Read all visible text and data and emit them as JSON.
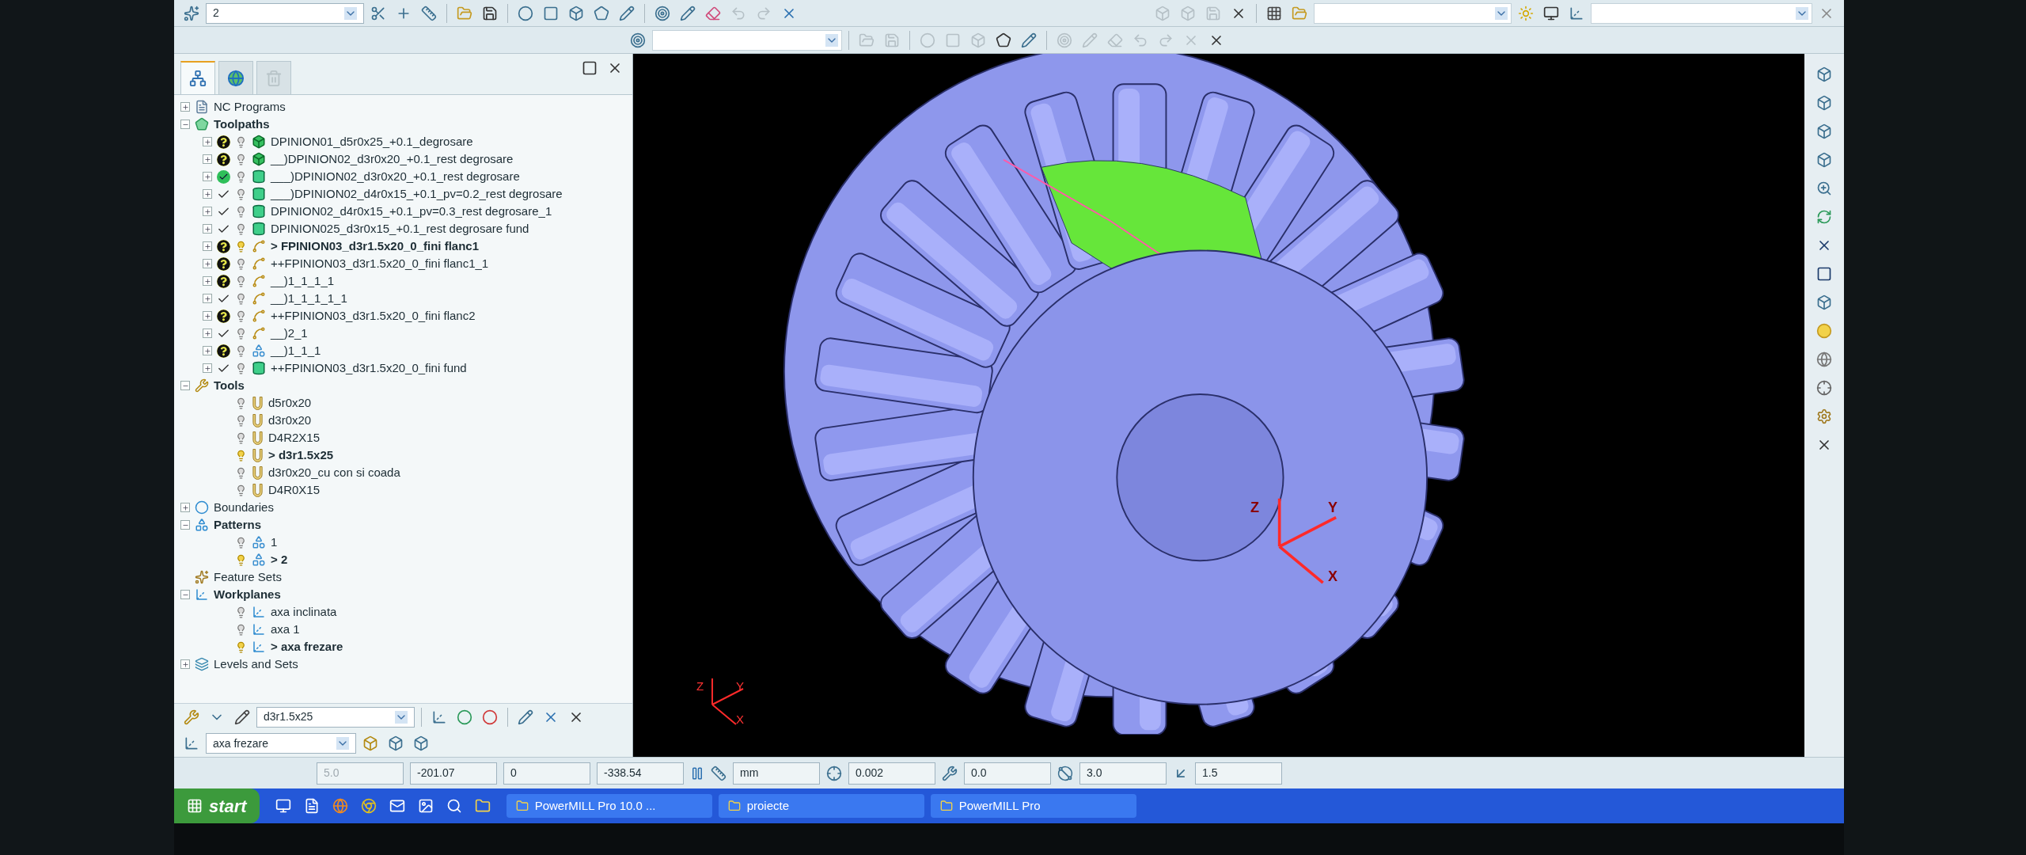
{
  "toolbar": {
    "layer_combo": "2"
  },
  "explorer": {
    "tabs": [
      {
        "selected": true,
        "kind": "tree"
      },
      {
        "selected": false,
        "kind": "globe"
      },
      {
        "selected": false,
        "kind": "bin"
      }
    ],
    "tree": [
      {
        "label": "NC Programs",
        "kind": "nc",
        "expanded": false
      },
      {
        "label": "Toolpaths",
        "kind": "toolpaths",
        "expanded": true,
        "children": [
          {
            "label": "DPINION01_d5r0x25_+0.1_degrosare",
            "calculated": false,
            "kind": "block",
            "active": false
          },
          {
            "label": "__)DPINION02_d3r0x20_+0.1_rest degrosare",
            "calculated": false,
            "kind": "block",
            "active": false
          },
          {
            "label": "___)DPINION02_d3r0x20_+0.1_rest degrosare",
            "calculated": true,
            "verified": true,
            "kind": "cylinder",
            "active": false
          },
          {
            "label": "___)DPINION02_d4r0x15_+0.1_pv=0.2_rest degrosare",
            "calculated": true,
            "verified": false,
            "kind": "cylinder",
            "active": false
          },
          {
            "label": "DPINION02_d4r0x15_+0.1_pv=0.3_rest degrosare_1",
            "calculated": true,
            "verified": false,
            "kind": "cylinder",
            "active": false
          },
          {
            "label": "DPINION025_d3r0x15_+0.1_rest degrosare fund",
            "calculated": true,
            "verified": false,
            "kind": "cylinder",
            "active": false
          },
          {
            "label": "> FPINION03_d3r1.5x20_0_fini flanc1",
            "calculated": false,
            "kind": "finish",
            "active": true
          },
          {
            "label": "++FPINION03_d3r1.5x20_0_fini flanc1_1",
            "calculated": false,
            "kind": "finish",
            "active": false
          },
          {
            "label": "__)1_1_1_1",
            "calculated": false,
            "kind": "finish",
            "active": false
          },
          {
            "label": "__)1_1_1_1_1",
            "calculated": true,
            "verified": false,
            "kind": "finish",
            "active": false
          },
          {
            "label": "++FPINION03_d3r1.5x20_0_fini flanc2",
            "calculated": false,
            "kind": "finish",
            "active": false
          },
          {
            "label": "__)2_1",
            "calculated": true,
            "verified": false,
            "kind": "finish",
            "active": false
          },
          {
            "label": "__)1_1_1",
            "calculated": false,
            "kind": "pattern",
            "active": false
          },
          {
            "label": "++FPINION03_d3r1.5x20_0_fini fund",
            "calculated": true,
            "verified": false,
            "kind": "cylinder",
            "active": false
          }
        ]
      },
      {
        "label": "Tools",
        "kind": "tools",
        "expanded": true,
        "children": [
          {
            "label": "d5r0x20",
            "kind": "tool",
            "active": false
          },
          {
            "label": "d3r0x20",
            "kind": "tool",
            "active": false
          },
          {
            "label": "D4R2X15",
            "kind": "tool",
            "active": false
          },
          {
            "label": "> d3r1.5x25",
            "kind": "tool",
            "active": true
          },
          {
            "label": "d3r0x20_cu con si coada",
            "kind": "tool",
            "active": false
          },
          {
            "label": "D4R0X15",
            "kind": "tool",
            "active": false
          }
        ]
      },
      {
        "label": "Boundaries",
        "kind": "boundaries",
        "expanded": false
      },
      {
        "label": "Patterns",
        "kind": "patterns",
        "expanded": true,
        "children": [
          {
            "label": "1",
            "kind": "pattern",
            "active": false
          },
          {
            "label": "> 2",
            "kind": "pattern",
            "active": true
          }
        ]
      },
      {
        "label": "Feature Sets",
        "kind": "features",
        "expanded": false
      },
      {
        "label": "Workplanes",
        "kind": "workplanes",
        "expanded": true,
        "children": [
          {
            "label": "axa inclinata",
            "kind": "workplane",
            "active": false
          },
          {
            "label": "axa 1",
            "kind": "workplane",
            "active": false
          },
          {
            "label": "> axa frezare",
            "kind": "workplane",
            "active": true
          }
        ]
      },
      {
        "label": "Levels and Sets",
        "kind": "levels",
        "expanded": false
      }
    ],
    "tool_combo": "d3r1.5x25",
    "workplane_combo": "axa frezare"
  },
  "viewport": {
    "corner_axes": [
      "Z",
      "Y",
      "X"
    ],
    "model_axes": [
      "Z",
      "Y",
      "X"
    ]
  },
  "status_bar": {
    "fields": [
      {
        "value": "5.0",
        "disabled": true
      },
      {
        "value": "-201.07",
        "disabled": false
      },
      {
        "value": "0",
        "disabled": false
      },
      {
        "value": "-338.54",
        "disabled": false
      }
    ],
    "units": "mm",
    "tolerance": "0.002",
    "thickness": "0.0",
    "diameter": "3.0",
    "stepover": "1.5"
  },
  "taskbar": {
    "start": "start",
    "tasks": [
      "PowerMILL Pro 10.0 ...",
      "proiecte",
      "PowerMILL Pro"
    ]
  }
}
